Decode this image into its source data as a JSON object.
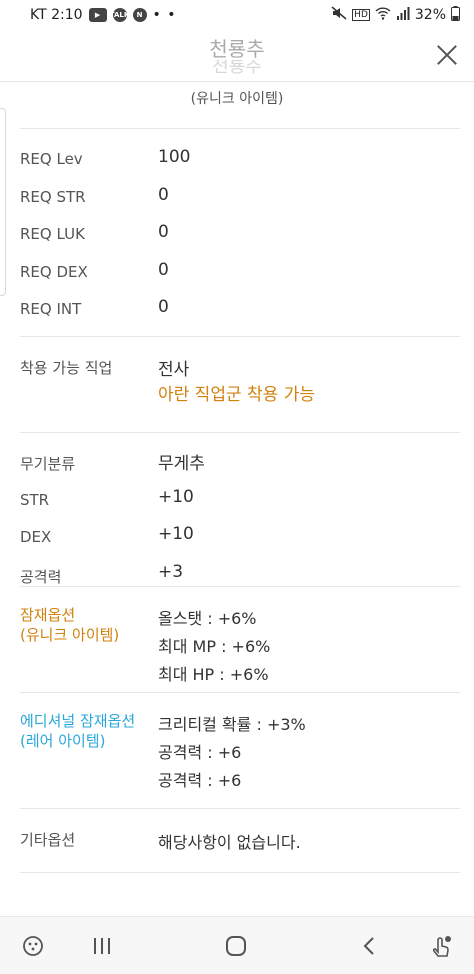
{
  "status_bar": {
    "carrier_time": "KT 2:10",
    "dots": "• •",
    "battery": "32%"
  },
  "header": {
    "title": "천룡추",
    "subtitle": "(유니크 아이템)"
  },
  "requirements": [
    {
      "label": "REQ Lev",
      "value": "100"
    },
    {
      "label": "REQ STR",
      "value": "0"
    },
    {
      "label": "REQ LUK",
      "value": "0"
    },
    {
      "label": "REQ DEX",
      "value": "0"
    },
    {
      "label": "REQ INT",
      "value": "0"
    }
  ],
  "job": {
    "label": "착용 가능 직업",
    "value": "전사",
    "note": "아란 직업군 착용 가능"
  },
  "stats": [
    {
      "label": "무기분류",
      "value": "무게추"
    },
    {
      "label": "STR",
      "value": "+10"
    },
    {
      "label": "DEX",
      "value": "+10"
    },
    {
      "label": "공격력",
      "value": "+3"
    }
  ],
  "potential": {
    "label_line1": "잠재옵션",
    "label_line2": "(유니크 아이템)",
    "lines": [
      "올스탯 : +6%",
      "최대 MP : +6%",
      "최대 HP : +6%"
    ]
  },
  "additional": {
    "label_line1": "에디셔널 잠재옵션",
    "label_line2": "(레어 아이템)",
    "lines": [
      "크리티컬 확률 : +3%",
      "공격력 : +6",
      "공격력 : +6"
    ]
  },
  "etc": {
    "label": "기타옵션",
    "value": "해당사항이 없습니다."
  },
  "colors": {
    "unique": "#d2820e",
    "rare": "#2aa7dc"
  },
  "nav_icons": [
    "game-launcher-icon",
    "recent-apps-icon",
    "home-icon",
    "back-icon",
    "touch-lock-icon"
  ]
}
